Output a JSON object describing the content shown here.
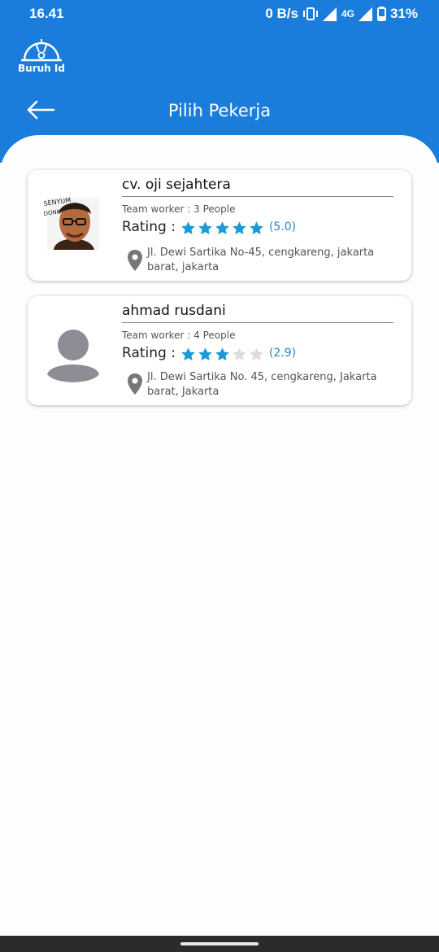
{
  "status_bar": {
    "time": "16.41",
    "network_speed": "0 B/s",
    "network_type": "4G",
    "battery": "31%"
  },
  "header": {
    "logo_text": "Buruh Id",
    "title": "Pilih Pekerja",
    "color": "#1a7ddb"
  },
  "workers": [
    {
      "name": "cv. oji sejahtera",
      "team": "Team worker : 3 People",
      "rating_label": "Rating :",
      "rating": 5.0,
      "rating_text": "(5.0)",
      "stars_filled": 5,
      "address": "Jl. Dewi Sartika No-45, cengkareng, jakarta barat, jakarta",
      "avatar": "photo"
    },
    {
      "name": "ahmad rusdani",
      "team": "Team worker : 4 People",
      "rating_label": "Rating :",
      "rating": 2.9,
      "rating_text": "(2.9)",
      "stars_filled": 3,
      "address": "Jl. Dewi Sartika No. 45, cengkareng, Jakarta barat, Jakarta",
      "avatar": "default-user-icon"
    }
  ],
  "colors": {
    "star_filled": "#1a9ad6",
    "star_empty": "#dcdcdc",
    "rating_text": "#2b86c5"
  }
}
